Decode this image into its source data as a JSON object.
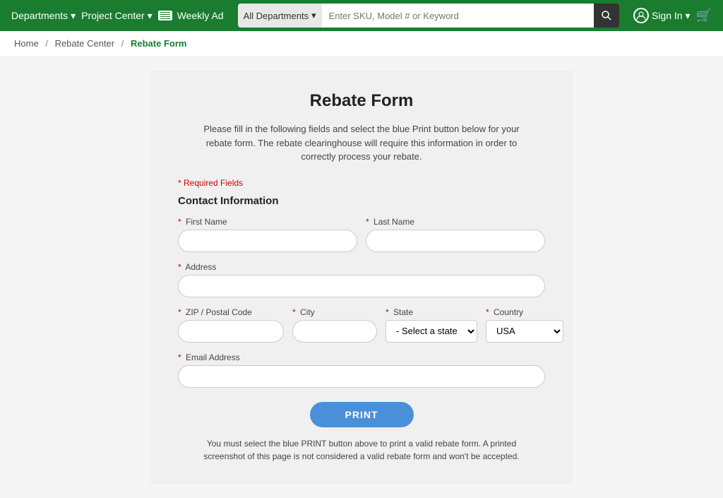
{
  "header": {
    "bg_color": "#1a7c2e",
    "departments_label": "Departments",
    "project_center_label": "Project Center",
    "weekly_ad_label": "Weekly Ad",
    "search": {
      "dept_label": "All Departments",
      "placeholder": "Enter SKU, Model # or Keyword"
    },
    "sign_in_label": "Sign In",
    "cart_label": "Cart"
  },
  "breadcrumb": {
    "home": "Home",
    "rebate_center": "Rebate Center",
    "current": "Rebate Form"
  },
  "form": {
    "title": "Rebate Form",
    "description": "Please fill in the following fields and select the blue Print button below for your rebate form. The rebate clearinghouse will require this information in order to correctly process your rebate.",
    "required_note": "* Required Fields",
    "contact_section": "Contact Information",
    "fields": {
      "first_name_label": "First Name",
      "last_name_label": "Last Name",
      "address_label": "Address",
      "zip_label": "ZIP / Postal Code",
      "city_label": "City",
      "state_label": "State",
      "country_label": "Country",
      "email_label": "Email Address"
    },
    "state_placeholder": "- Select a state -",
    "country_default": "USA",
    "print_btn": "PRINT",
    "print_notice": "You must select the blue PRINT button above to print a valid rebate form. A printed screenshot of this page is not considered a valid rebate form and won't be accepted."
  }
}
